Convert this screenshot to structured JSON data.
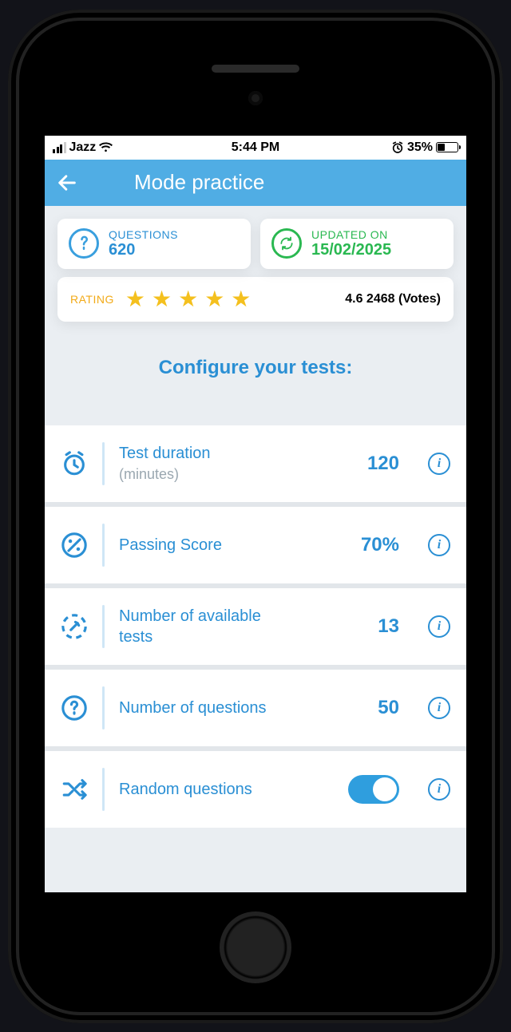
{
  "status": {
    "carrier": "Jazz",
    "time": "5:44 PM",
    "battery_pct": "35%"
  },
  "header": {
    "title": "Mode practice"
  },
  "info": {
    "questions_label": "QUESTIONS",
    "questions_value": "620",
    "updated_label": "UPDATED ON",
    "updated_value": "15/02/2025"
  },
  "rating": {
    "label": "RATING",
    "score": "4.6",
    "votes": "2468",
    "votes_suffix": "(Votes)",
    "display": "4.6 2468 (Votes)"
  },
  "configure_heading": "Configure your tests:",
  "rows": {
    "duration": {
      "label": "Test duration",
      "sub": "(minutes)",
      "value": "120"
    },
    "passing": {
      "label": "Passing Score",
      "value": "70%"
    },
    "tests": {
      "label": "Number of available tests",
      "value": "13"
    },
    "questions": {
      "label": "Number of questions",
      "value": "50"
    },
    "random": {
      "label": "Random questions",
      "on": true
    }
  }
}
